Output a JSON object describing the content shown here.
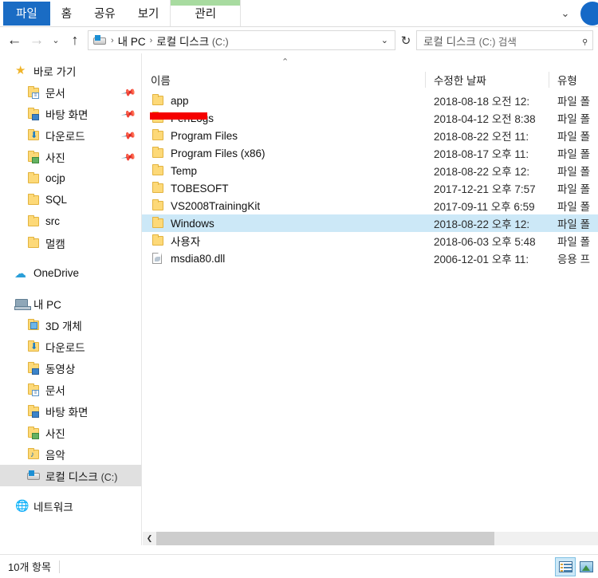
{
  "window": {
    "ribbon_tabs": [
      {
        "label": "파일",
        "name": "tab-file"
      },
      {
        "label": "홈",
        "name": "tab-home"
      },
      {
        "label": "공유",
        "name": "tab-share"
      },
      {
        "label": "보기",
        "name": "tab-view"
      },
      {
        "label": "관리",
        "name": "tab-manage"
      }
    ],
    "ribbon_expand_icon": "chevron-down-icon",
    "help_button": "help-icon",
    "context_tab_color": "#a8dba0",
    "file_tab_color": "#1a6cc4"
  },
  "toolbar": {
    "back": "←",
    "forward": "→",
    "recent": "⌄",
    "up": "↑",
    "refresh": "↻",
    "dropdown": "⌄"
  },
  "address": {
    "icon": "drive-icon",
    "crumbs": [
      {
        "label": "내 PC",
        "dim": ""
      },
      {
        "label": "로컬 디스크 ",
        "dim": "(C:)"
      }
    ],
    "separator": "›"
  },
  "search": {
    "placeholder": "로컬 디스크 (C:) 검색",
    "placeholder_main": "로컬 디스크 ",
    "placeholder_dim": "(C:) 검색",
    "icon": "search-icon"
  },
  "sidebar": {
    "groups": [
      {
        "header": {
          "label": "바로 가기",
          "icon": "star-icon",
          "level": 0,
          "selected": false
        },
        "items": [
          {
            "label": "문서",
            "icon": "folder-documents-icon",
            "pinned": true,
            "level": 1,
            "selected": false
          },
          {
            "label": "바탕 화면",
            "icon": "folder-desktop-icon",
            "pinned": true,
            "level": 1,
            "selected": false
          },
          {
            "label": "다운로드",
            "icon": "folder-downloads-icon",
            "pinned": true,
            "level": 1,
            "selected": false
          },
          {
            "label": "사진",
            "icon": "folder-pictures-icon",
            "pinned": true,
            "level": 1,
            "selected": false
          },
          {
            "label": "ocjp",
            "icon": "folder-icon",
            "pinned": false,
            "level": 1,
            "selected": false
          },
          {
            "label": "SQL",
            "icon": "folder-icon",
            "pinned": false,
            "level": 1,
            "selected": false
          },
          {
            "label": "src",
            "icon": "folder-icon",
            "pinned": false,
            "level": 1,
            "selected": false
          },
          {
            "label": "멀캠",
            "icon": "folder-icon",
            "pinned": false,
            "level": 1,
            "selected": false
          }
        ]
      },
      {
        "header": {
          "label": "OneDrive",
          "icon": "cloud-icon",
          "level": 0,
          "selected": false
        },
        "items": []
      },
      {
        "header": {
          "label": "내 PC",
          "icon": "pc-icon",
          "level": 0,
          "selected": false
        },
        "items": [
          {
            "label": "3D 개체",
            "icon": "folder-3dobjects-icon",
            "pinned": false,
            "level": 1,
            "selected": false
          },
          {
            "label": "다운로드",
            "icon": "folder-downloads-icon",
            "pinned": false,
            "level": 1,
            "selected": false
          },
          {
            "label": "동영상",
            "icon": "folder-videos-icon",
            "pinned": false,
            "level": 1,
            "selected": false
          },
          {
            "label": "문서",
            "icon": "folder-documents-icon",
            "pinned": false,
            "level": 1,
            "selected": false
          },
          {
            "label": "바탕 화면",
            "icon": "folder-desktop-icon",
            "pinned": false,
            "level": 1,
            "selected": false
          },
          {
            "label": "사진",
            "icon": "folder-pictures-icon",
            "pinned": false,
            "level": 1,
            "selected": false
          },
          {
            "label": "음악",
            "icon": "folder-music-icon",
            "pinned": false,
            "level": 1,
            "selected": false
          },
          {
            "label": "로컬 디스크 ",
            "label_dim": "(C:)",
            "icon": "drive-icon",
            "pinned": false,
            "level": 1,
            "selected": true
          }
        ]
      },
      {
        "header": {
          "label": "네트워크",
          "icon": "network-icon",
          "level": 0,
          "selected": false
        },
        "items": []
      }
    ],
    "selected_bg": "#e0e0e0"
  },
  "filelist": {
    "sort_indicator": "⌃",
    "columns": [
      {
        "label": "이름",
        "name": "column-header-name"
      },
      {
        "label": "수정한 날짜",
        "name": "column-header-date"
      },
      {
        "label": "유형",
        "name": "column-header-type"
      }
    ],
    "selected_bg": "#cce8f7",
    "rows": [
      {
        "name": "app",
        "date": "2018-08-18 오전 12:",
        "type": "파일 폴",
        "icon": "folder-icon",
        "selected": false,
        "redacted": false
      },
      {
        "name": "PerfLogs",
        "date": "2018-04-12 오전 8:38",
        "type": "파일 폴",
        "icon": "folder-icon",
        "selected": false,
        "redacted": true
      },
      {
        "name": "Program Files",
        "date": "2018-08-22 오전 11:",
        "type": "파일 폴",
        "icon": "folder-icon",
        "selected": false,
        "redacted": false
      },
      {
        "name": "Program Files (x86)",
        "date": "2018-08-17 오후 11:",
        "type": "파일 폴",
        "icon": "folder-icon",
        "selected": false,
        "redacted": false
      },
      {
        "name": "Temp",
        "date": "2018-08-22 오후 12:",
        "type": "파일 폴",
        "icon": "folder-icon",
        "selected": false,
        "redacted": false
      },
      {
        "name": "TOBESOFT",
        "date": "2017-12-21 오후 7:57",
        "type": "파일 폴",
        "icon": "folder-icon",
        "selected": false,
        "redacted": false
      },
      {
        "name": "VS2008TrainingKit",
        "date": "2017-09-11 오후 6:59",
        "type": "파일 폴",
        "icon": "folder-icon",
        "selected": false,
        "redacted": false
      },
      {
        "name": "Windows",
        "date": "2018-08-22 오후 12:",
        "type": "파일 폴",
        "icon": "folder-icon",
        "selected": true,
        "redacted": false
      },
      {
        "name": "사용자",
        "date": "2018-06-03 오후 5:48",
        "type": "파일 폴",
        "icon": "folder-icon",
        "selected": false,
        "redacted": false
      },
      {
        "name": "msdia80.dll",
        "date": "2006-12-01 오후 11:",
        "type": "응용 프",
        "icon": "dll-file-icon",
        "selected": false,
        "redacted": false
      }
    ]
  },
  "scrollbar": {
    "left_arrow": "❮"
  },
  "statusbar": {
    "item_count": "10개 항목",
    "view_details": "details-view-icon",
    "view_large_icons": "large-icons-view-icon"
  }
}
